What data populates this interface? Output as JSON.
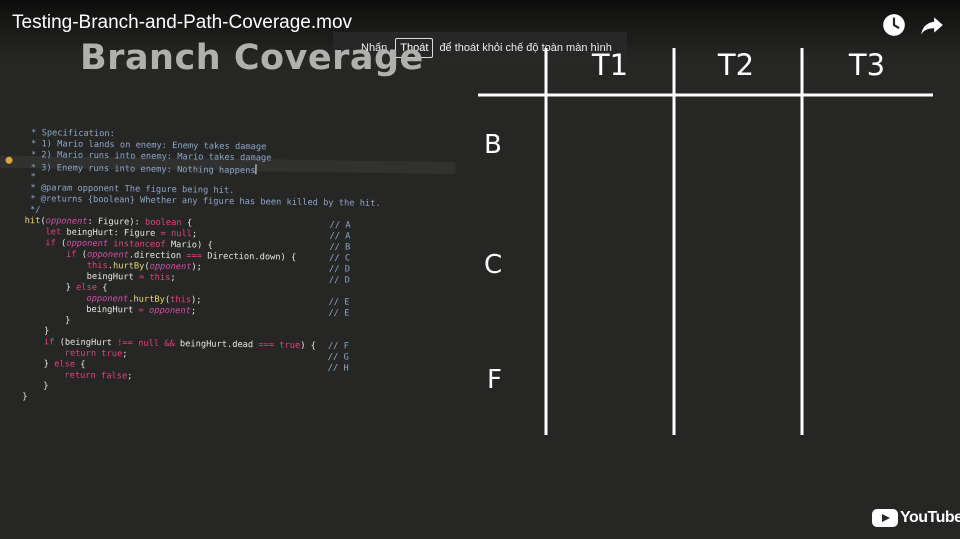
{
  "player": {
    "title": "Testing-Branch-and-Path-Coverage.mov",
    "icons": {
      "watch_later": "clock-icon",
      "share": "share-icon"
    },
    "fullscreen_toast": {
      "before": "Nhấn",
      "key": "Thoát",
      "after": "để thoát khỏi chế độ toàn màn hình"
    },
    "brand": "YouTube"
  },
  "slide": {
    "title": "Branch Coverage",
    "table": {
      "columns": [
        "T1",
        "T2",
        "T3"
      ],
      "rows": [
        "B",
        "C",
        "F"
      ]
    }
  },
  "code": {
    "spec_lines": [
      " * Specification:",
      " * 1) Mario lands on enemy: Enemy takes damage",
      " * 2) Mario runs into enemy: Mario takes damage",
      " * 3) Enemy runs into enemy: Nothing happens",
      " *",
      " * @param opponent The figure being hit.",
      " * @returns {boolean} Whether any figure has been killed by the hit.",
      " */"
    ],
    "body_lines": [
      {
        "text": "hit(opponent: Figure): boolean {",
        "mark": "// A"
      },
      {
        "text": "    let beingHurt: Figure = null;",
        "mark": "// A"
      },
      {
        "text": "    if (opponent instanceof Mario) {",
        "mark": "// B"
      },
      {
        "text": "        if (opponent.direction === Direction.down) {",
        "mark": "// C"
      },
      {
        "text": "            this.hurtBy(opponent);",
        "mark": "// D"
      },
      {
        "text": "            beingHurt = this;",
        "mark": "// D"
      },
      {
        "text": "        } else {",
        "mark": ""
      },
      {
        "text": "            opponent.hurtBy(this);",
        "mark": "// E"
      },
      {
        "text": "            beingHurt = opponent;",
        "mark": "// E"
      },
      {
        "text": "        }",
        "mark": ""
      },
      {
        "text": "    }",
        "mark": ""
      },
      {
        "text": "    if (beingHurt !== null && beingHurt.dead === true) {",
        "mark": "// F"
      },
      {
        "text": "        return true;",
        "mark": "// G"
      },
      {
        "text": "    } else {",
        "mark": "// H"
      },
      {
        "text": "        return false;",
        "mark": ""
      },
      {
        "text": "    }",
        "mark": ""
      },
      {
        "text": "}",
        "mark": ""
      }
    ]
  },
  "colors": {
    "background": "#262624",
    "comment": "#8ba6c9",
    "keyword": "#e2417c",
    "parameter": "#cf4fa5",
    "function": "#e8d87a",
    "youtube_red": "#ff0000"
  }
}
